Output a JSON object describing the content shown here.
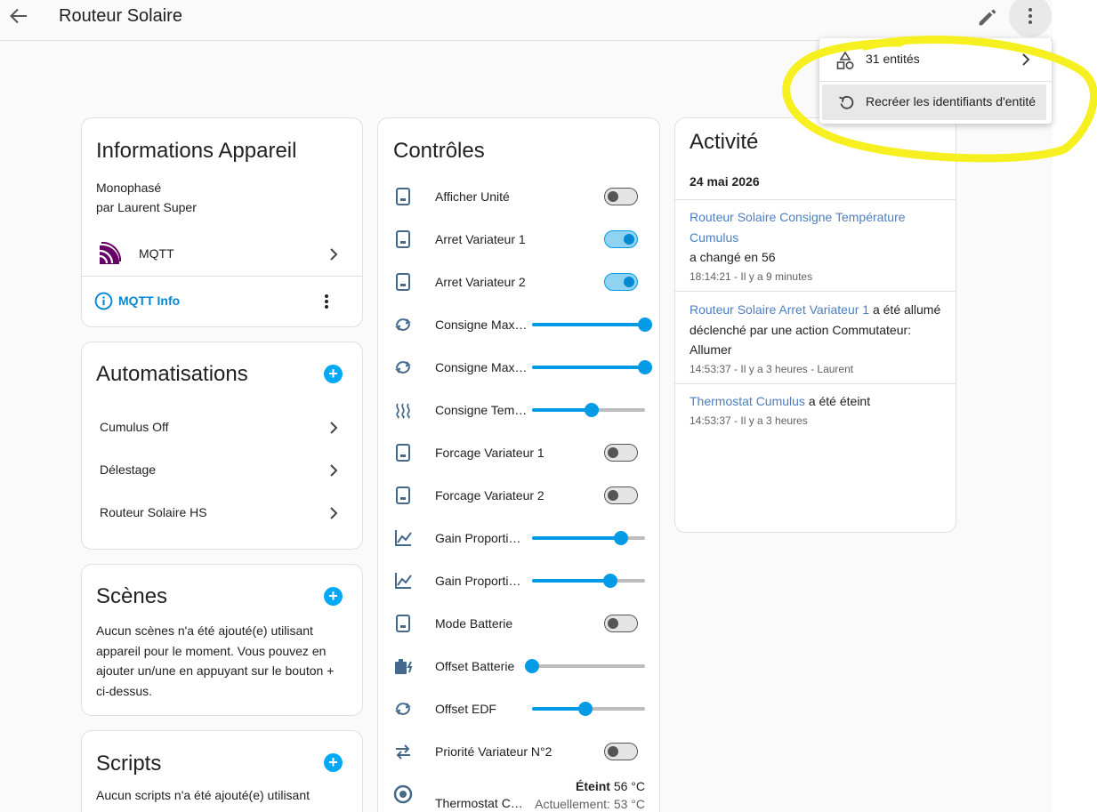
{
  "header": {
    "title": "Routeur Solaire"
  },
  "device_info": {
    "title": "Informations Appareil",
    "model": "Monophasé",
    "manufacturer": "par Laurent Super",
    "integration": {
      "label": "MQTT",
      "icon": "mqtt-icon"
    },
    "mqtt_info_label": "MQTT Info"
  },
  "automations": {
    "title": "Automatisations",
    "items": [
      "Cumulus Off",
      "Délestage",
      "Routeur Solaire HS"
    ]
  },
  "scenes": {
    "title": "Scènes",
    "empty_text": "Aucun scènes n'a été ajouté(e) utilisant appareil pour le moment. Vous pouvez en ajouter un/une en appuyant sur le bouton + ci-dessus."
  },
  "scripts": {
    "title": "Scripts",
    "empty_text": "Aucun scripts n'a été ajouté(e) utilisant"
  },
  "controls": {
    "title": "Contrôles",
    "items": [
      {
        "label": "Afficher Unité",
        "icon": "cellphone-icon",
        "type": "toggle",
        "on": false
      },
      {
        "label": "Arret Variateur 1",
        "icon": "cellphone-icon",
        "type": "toggle",
        "on": true
      },
      {
        "label": "Arret Variateur 2",
        "icon": "cellphone-icon",
        "type": "toggle",
        "on": true
      },
      {
        "label": "Consigne Max…",
        "icon": "cycle-arrows-icon",
        "type": "slider",
        "value": 1.0
      },
      {
        "label": "Consigne Max…",
        "icon": "cycle-arrows-icon",
        "type": "slider",
        "value": 1.0
      },
      {
        "label": "Consigne Tem…",
        "icon": "heat-waves-icon",
        "type": "slider",
        "value": 0.53
      },
      {
        "label": "Forcage Variateur 1",
        "icon": "cellphone-icon",
        "type": "toggle",
        "on": false
      },
      {
        "label": "Forcage Variateur 2",
        "icon": "cellphone-icon",
        "type": "toggle",
        "on": false
      },
      {
        "label": "Gain Proporti…",
        "icon": "chart-line-icon",
        "type": "slider",
        "value": 0.79
      },
      {
        "label": "Gain Proporti…",
        "icon": "chart-line-icon",
        "type": "slider",
        "value": 0.69
      },
      {
        "label": "Mode Batterie",
        "icon": "cellphone-icon",
        "type": "toggle",
        "on": false
      },
      {
        "label": "Offset Batterie",
        "icon": "battery-charging-icon",
        "type": "slider",
        "value": 0.0
      },
      {
        "label": "Offset EDF",
        "icon": "cycle-arrows-icon",
        "type": "slider",
        "value": 0.47
      },
      {
        "label": "Priorité Variateur N°2",
        "icon": "swap-arrows-icon",
        "type": "toggle",
        "on": false
      },
      {
        "label": "Thermostat C…",
        "icon": "thermostat-icon",
        "type": "climate",
        "state": "Éteint",
        "target": "56 °C",
        "current": "Actuellement: 53 °C"
      }
    ]
  },
  "activity": {
    "title": "Activité",
    "date": "24 mai 2026",
    "entries": [
      {
        "link": "Routeur Solaire Consigne Température Cumulus",
        "text": "a changé en 56",
        "meta": "18:14:21 - Il y a 9 minutes"
      },
      {
        "link": "Routeur Solaire Arret Variateur 1",
        "text": "a été allumé déclenché par une action Commutateur: Allumer",
        "meta": "14:53:37 - Il y a 3 heures - Laurent"
      },
      {
        "link": "Thermostat Cumulus",
        "text": "a été éteint",
        "meta": "14:53:37 - Il y a 3 heures"
      }
    ]
  },
  "menu": {
    "entities_label": "31 entités",
    "recreate_label": "Recréer les identifiants d'entité"
  },
  "colors": {
    "accent": "#03a9f4",
    "slider": "#039be5",
    "link": "#4c7fbf",
    "highlight": "#f5ef14"
  }
}
